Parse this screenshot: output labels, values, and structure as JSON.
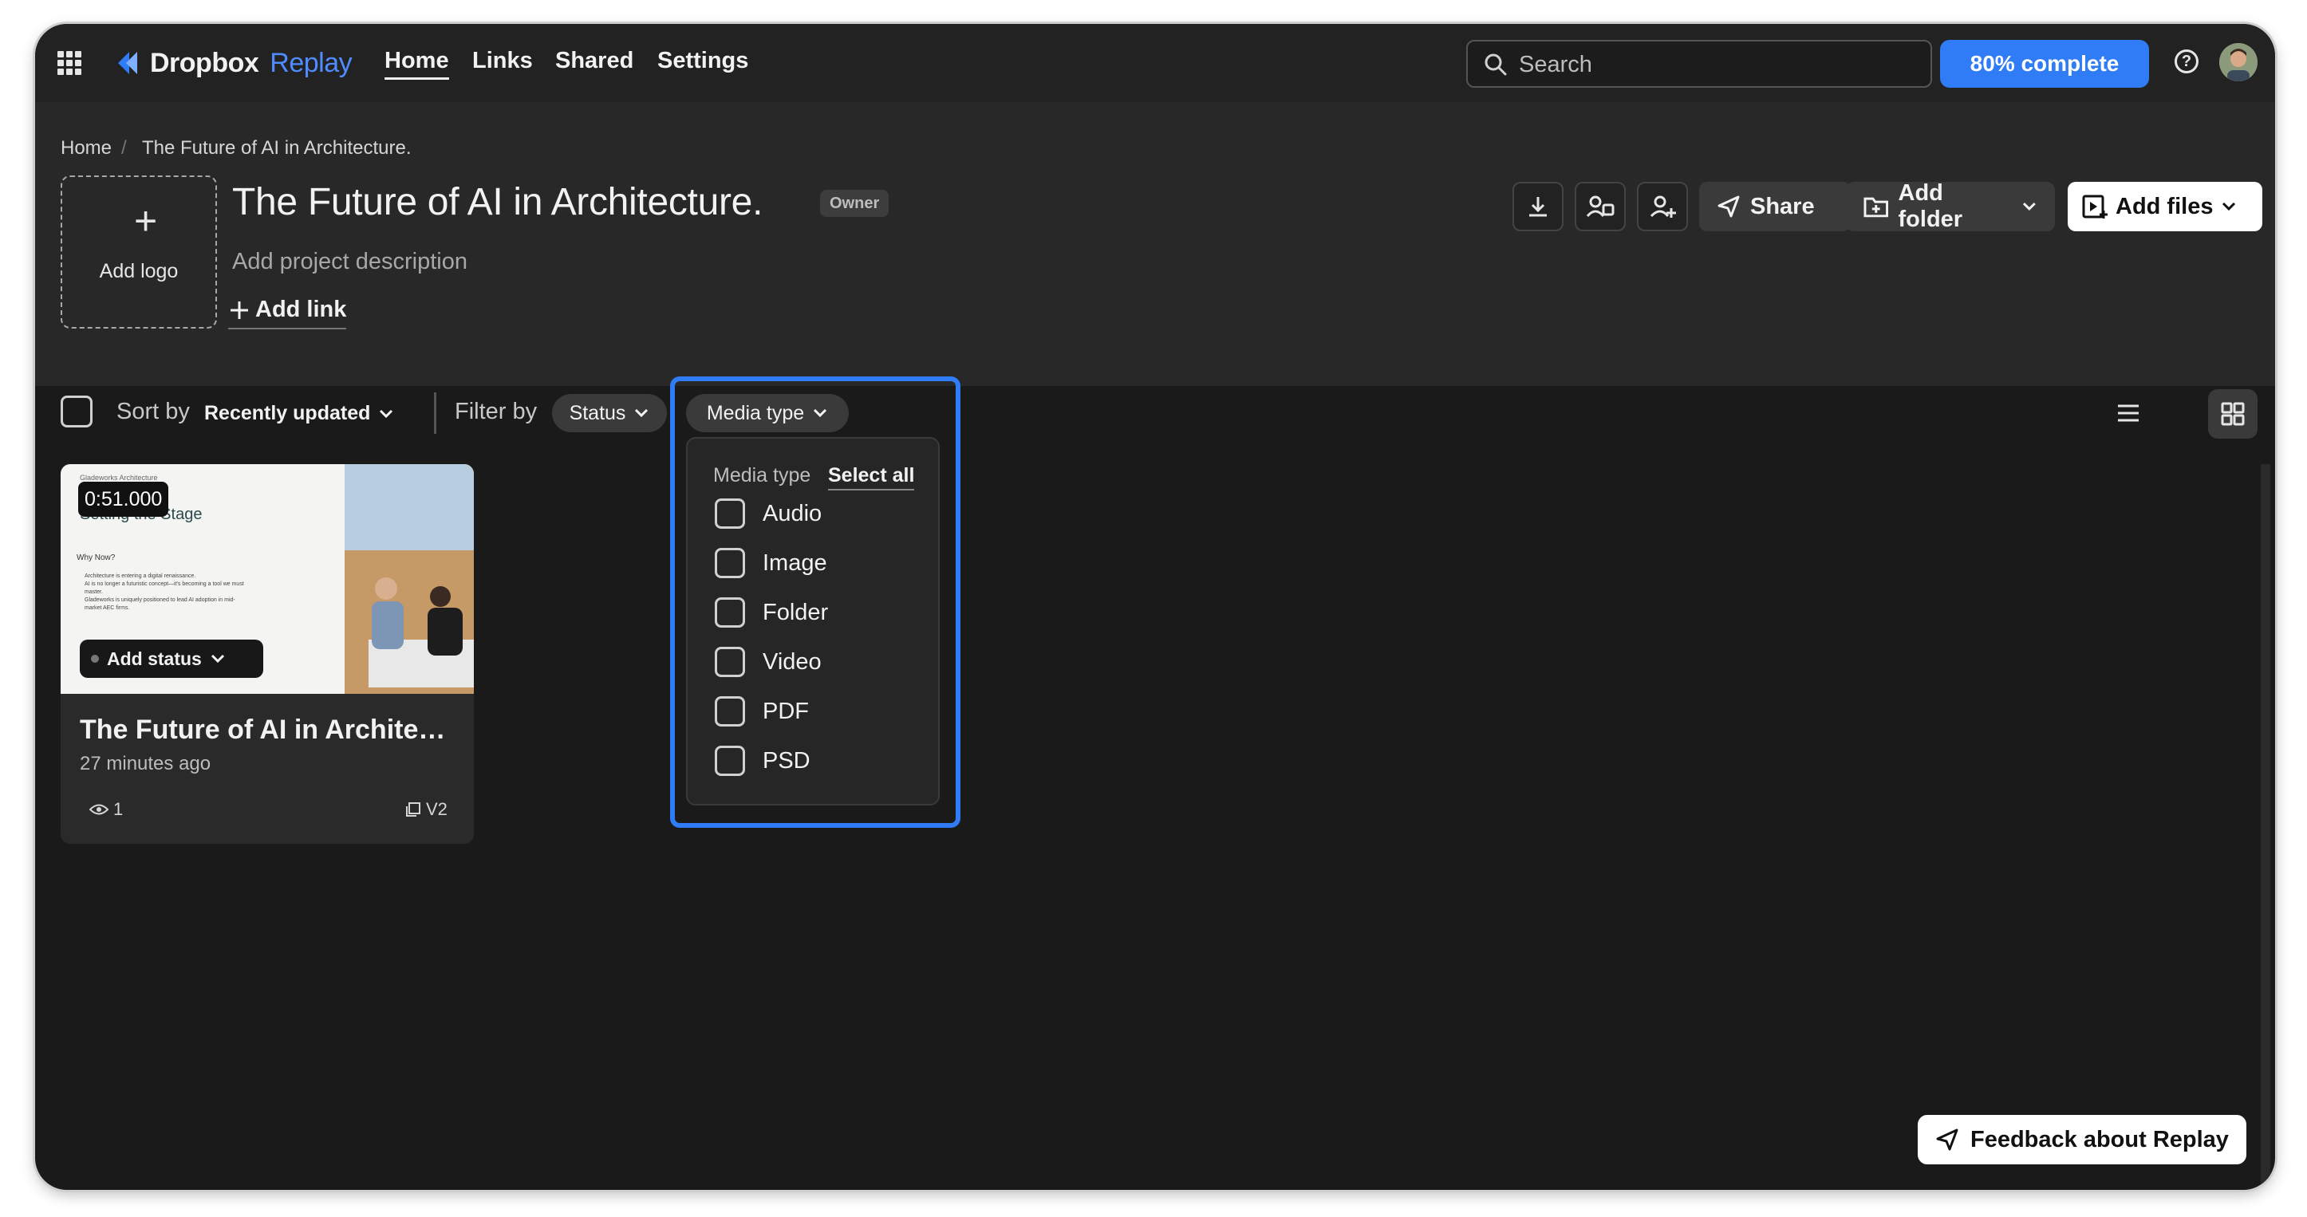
{
  "topbar": {
    "brand": "Dropbox",
    "brand_sub": "Replay",
    "nav": [
      "Home",
      "Links",
      "Shared",
      "Settings"
    ],
    "search_placeholder": "Search",
    "progress_label": "80% complete",
    "progress_fraction": 0.8
  },
  "breadcrumb": {
    "home": "Home",
    "separator": "/",
    "current": "The Future of AI in Architecture."
  },
  "project": {
    "add_logo": "Add logo",
    "title": "The Future of AI in Architecture.",
    "role_badge": "Owner",
    "description_placeholder": "Add project description",
    "add_link": "Add link"
  },
  "actions": {
    "share": "Share",
    "add_folder": "Add folder",
    "add_files": "Add files"
  },
  "toolbar": {
    "sort_label": "Sort by",
    "sort_value": "Recently updated",
    "filter_label": "Filter by",
    "status_chip": "Status",
    "media_chip": "Media type"
  },
  "media_dropdown": {
    "header": "Media type",
    "select_all": "Select all",
    "options": [
      {
        "label": "Audio",
        "checked": false
      },
      {
        "label": "Image",
        "checked": false
      },
      {
        "label": "Folder",
        "checked": false
      },
      {
        "label": "Video",
        "checked": false
      },
      {
        "label": "PDF",
        "checked": false
      },
      {
        "label": "PSD",
        "checked": false
      }
    ]
  },
  "card": {
    "duration": "0:51.000",
    "add_status": "Add status",
    "title": "The Future of AI in Architec...",
    "updated": "27 minutes ago",
    "views": "1",
    "version": "V2",
    "slide_heading": "Setting the Stage",
    "slide_kicker": "Gladeworks Architecture",
    "slide_subheading": "Why Now?",
    "slide_bullets": [
      "Architecture is entering a digital renaissance.",
      "AI is no longer a futuristic concept—it's becoming a tool we must master.",
      "Gladeworks is uniquely positioned to lead AI adoption in mid-market AEC firms."
    ]
  },
  "feedback_button": "Feedback about Replay",
  "colors": {
    "accent": "#2f7cf6",
    "background": "#1a1a1a",
    "header": "#282828"
  }
}
